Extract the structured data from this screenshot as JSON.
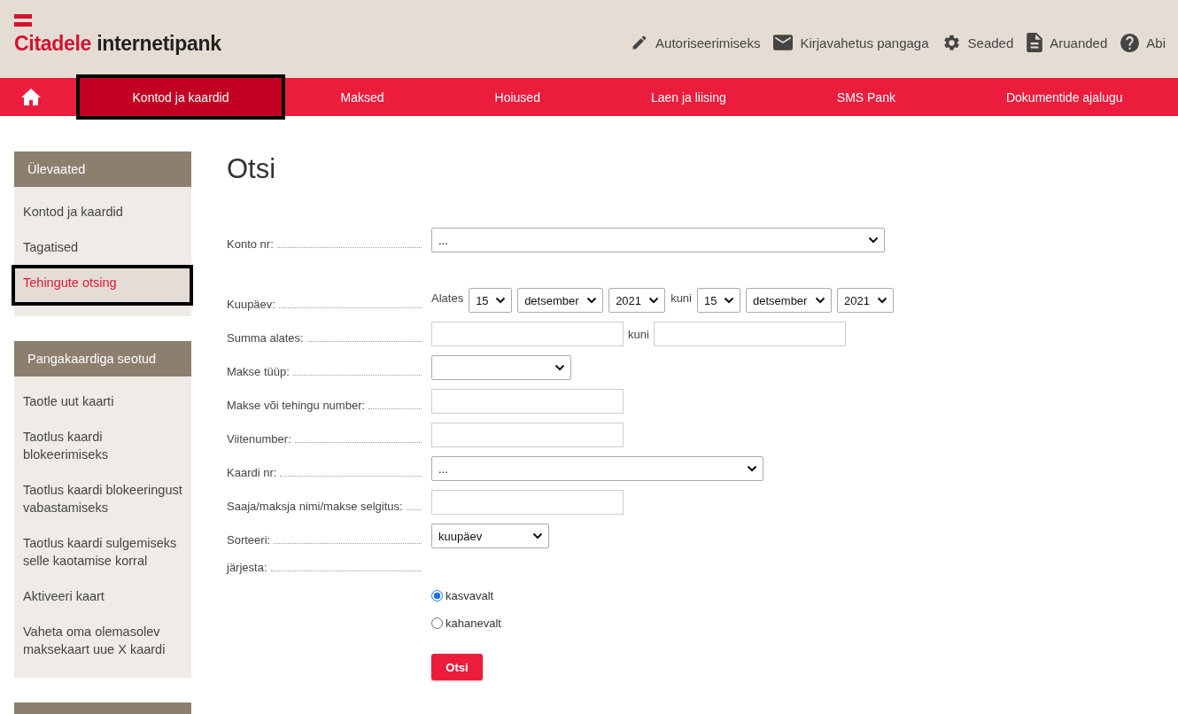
{
  "header": {
    "logo": {
      "brand": "Citadele",
      "product": "internetipank"
    },
    "top_links": [
      {
        "label": "Autoriseerimiseks"
      },
      {
        "label": "Kirjavahetus pangaga"
      },
      {
        "label": "Seaded"
      },
      {
        "label": "Aruanded"
      },
      {
        "label": "Abi"
      }
    ]
  },
  "nav": {
    "tabs": [
      {
        "label": "Kontod ja kaardid",
        "selected": true
      },
      {
        "label": "Maksed",
        "selected": false
      },
      {
        "label": "Hoiused",
        "selected": false
      },
      {
        "label": "Laen ja liising",
        "selected": false
      },
      {
        "label": "SMS Pank",
        "selected": false
      },
      {
        "label": "Dokumentide ajalugu",
        "selected": false
      }
    ]
  },
  "sidebar": {
    "sections": [
      {
        "title": "Ülevaated",
        "items": [
          {
            "label": "Kontod ja kaardid",
            "selected": false
          },
          {
            "label": "Tagatised",
            "selected": false
          },
          {
            "label": "Tehingute otsing",
            "selected": true
          }
        ]
      },
      {
        "title": "Pangakaardiga seotud",
        "items": [
          {
            "label": "Taotle uut kaarti",
            "selected": false
          },
          {
            "label": "Taotlus kaardi blokeerimiseks",
            "selected": false
          },
          {
            "label": "Taotlus kaardi blokeeringust vabastamiseks",
            "selected": false
          },
          {
            "label": "Taotlus kaardi sulgemiseks selle kaotamise korral",
            "selected": false
          },
          {
            "label": "Aktiveeri kaart",
            "selected": false
          },
          {
            "label": "Vaheta oma olemasolev maksekaart uue X kaardi",
            "selected": false
          }
        ]
      }
    ]
  },
  "form": {
    "title": "Otsi",
    "fields": [
      {
        "kind": "select",
        "label": "Konto nr:",
        "value": "..."
      },
      {
        "kind": "date_range",
        "label": "Kuupäev:",
        "from_label": "Alates",
        "from": {
          "day": "15",
          "month": "detsember",
          "year": "2021"
        },
        "to_label": "kuni",
        "to": {
          "day": "15",
          "month": "detsember",
          "year": "2021"
        }
      },
      {
        "kind": "range",
        "label": "Summa alates:",
        "to_label": "kuni"
      },
      {
        "kind": "select",
        "label": "Makse tüüp:"
      },
      {
        "kind": "text",
        "label": "Makse või tehingu number:"
      },
      {
        "kind": "text",
        "label": "Viitenumber:"
      },
      {
        "kind": "select",
        "label": "Kaardi nr:",
        "value": "..."
      },
      {
        "kind": "text",
        "label": "Saaja/maksja nimi/makse selgitus:"
      },
      {
        "kind": "select",
        "label": "Sorteeri:",
        "value": "kuupäev"
      },
      {
        "kind": "radio",
        "label": "järjesta:",
        "options": [
          {
            "label": "kasvavalt",
            "selected": true
          },
          {
            "label": "kahanevalt",
            "selected": false
          }
        ]
      }
    ],
    "submit": "Otsi"
  }
}
